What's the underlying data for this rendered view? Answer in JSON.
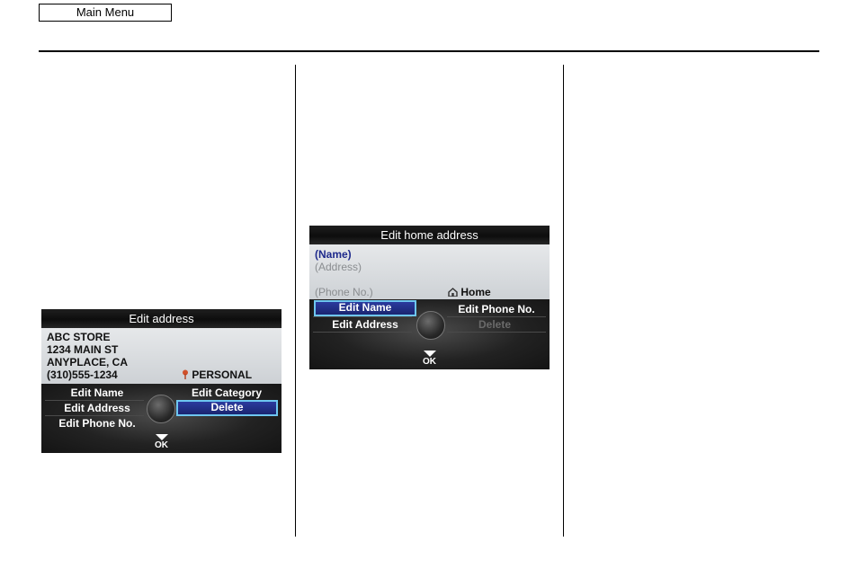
{
  "header": {
    "main_menu_label": "Main Menu"
  },
  "screen1": {
    "title": "Edit address",
    "info": {
      "name": "ABC STORE",
      "street": "1234 MAIN ST",
      "city": "ANYPLACE, CA",
      "phone": "(310)555-1234",
      "category": "PERSONAL"
    },
    "menu": {
      "edit_name": "Edit Name",
      "edit_address": "Edit Address",
      "edit_phone": "Edit Phone No.",
      "edit_category": "Edit Category",
      "delete": "Delete"
    },
    "ok_label": "OK"
  },
  "screen2": {
    "title": "Edit home address",
    "info": {
      "name": "(Name)",
      "address": "(Address)",
      "phone": "(Phone No.)",
      "home": "Home"
    },
    "menu": {
      "edit_name": "Edit Name",
      "edit_address": "Edit Address",
      "edit_phone": "Edit Phone No.",
      "delete": "Delete"
    },
    "ok_label": "OK"
  },
  "colors": {
    "selection": "#2b3a9e",
    "selection_border": "#6ec6f0",
    "category_pin": "#d0502a"
  }
}
